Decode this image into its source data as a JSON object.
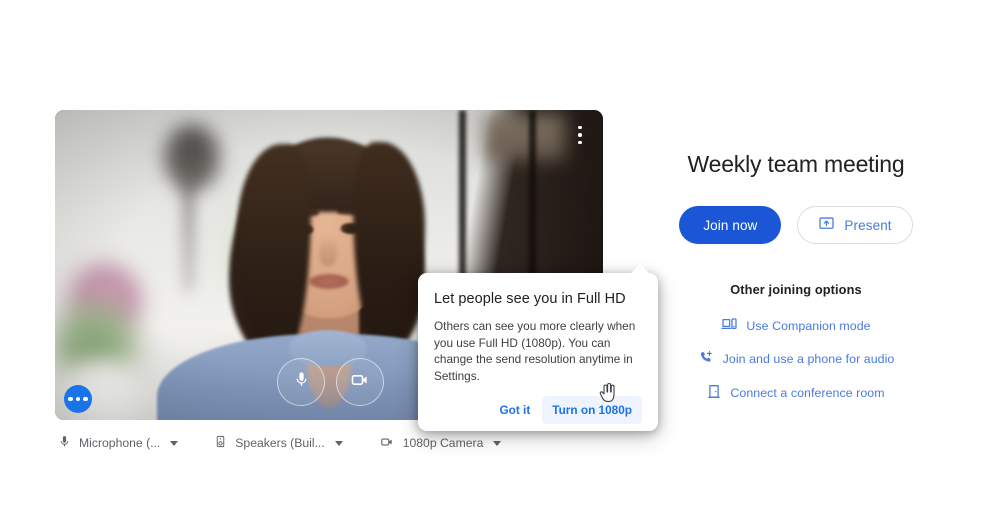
{
  "video_preview": {
    "kebab_menu": "more-options",
    "controls": [
      {
        "name": "microphone-toggle",
        "icon": "microphone-icon"
      },
      {
        "name": "camera-toggle",
        "icon": "video-camera-icon"
      },
      {
        "name": "visual-effects",
        "icon": "sparkle-icon"
      }
    ],
    "more_button": "more-options-dots"
  },
  "hd_dialog": {
    "title": "Let people see you in Full HD",
    "body": "Others can see you more clearly when you use Full HD (1080p). You can change the send resolution anytime in Settings.",
    "dismiss_label": "Got it",
    "confirm_label": "Turn on 1080p"
  },
  "devices": [
    {
      "icon": "microphone-icon",
      "label": "Microphone (...",
      "name": "microphone-selector"
    },
    {
      "icon": "speaker-icon",
      "label": "Speakers (Buil...",
      "name": "speaker-selector"
    },
    {
      "icon": "camera-icon",
      "label": "1080p Camera",
      "name": "camera-selector"
    }
  ],
  "join_panel": {
    "meeting_title": "Weekly team meeting",
    "join_label": "Join now",
    "present_label": "Present",
    "other_options_label": "Other joining options",
    "options": [
      {
        "label": "Use Companion mode",
        "icon": "companion-mode-icon",
        "name": "use-companion-mode"
      },
      {
        "label": "Join and use a phone for audio",
        "icon": "phone-audio-icon",
        "name": "join-phone-audio"
      },
      {
        "label": "Connect a conference room",
        "icon": "conference-room-icon",
        "name": "connect-conference-room"
      }
    ]
  },
  "colors": {
    "accent_blue": "#1a56d6",
    "link_blue": "#4a7ae0",
    "dialog_link": "#1a73e8",
    "text_primary": "#202124",
    "text_secondary": "#5f6368"
  }
}
